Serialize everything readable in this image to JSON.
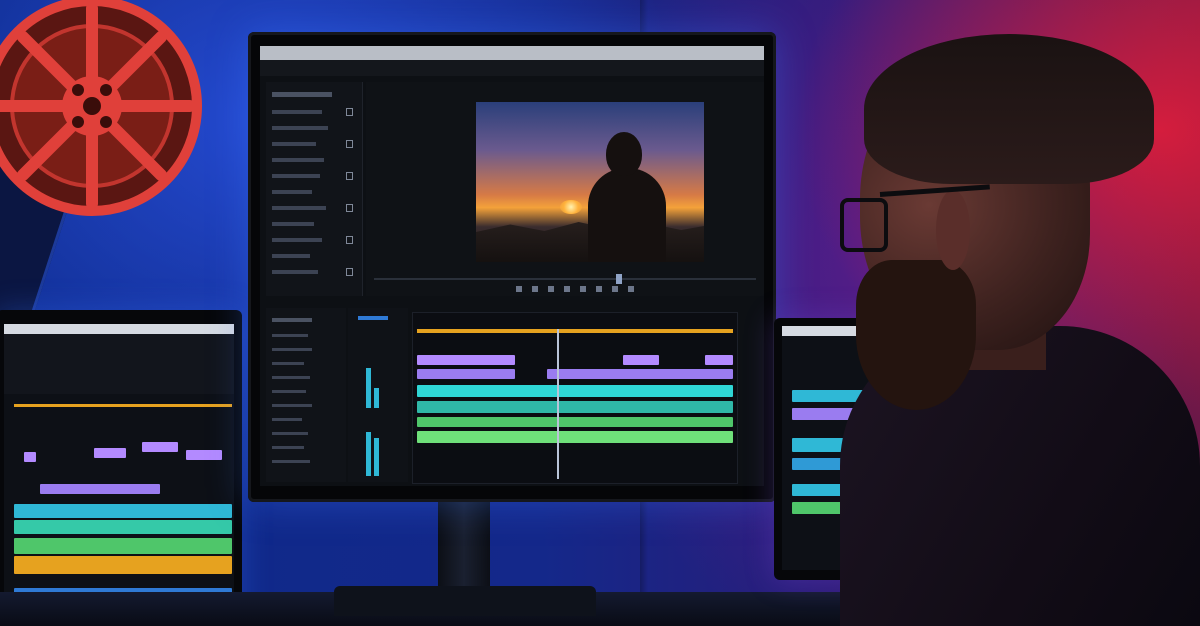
{
  "scene": {
    "description_colors": {
      "backdrop_blue": "#1f3fb0",
      "backdrop_red": "#e81e3a",
      "reel_red": "#e0403a",
      "timeline_purple": "#b38aff",
      "timeline_teal": "#2fd6d6",
      "timeline_green": "#6fe07a",
      "timeline_orange": "#e6a21f"
    }
  },
  "main_monitor": {
    "app_title": "",
    "viewer_label": ""
  }
}
